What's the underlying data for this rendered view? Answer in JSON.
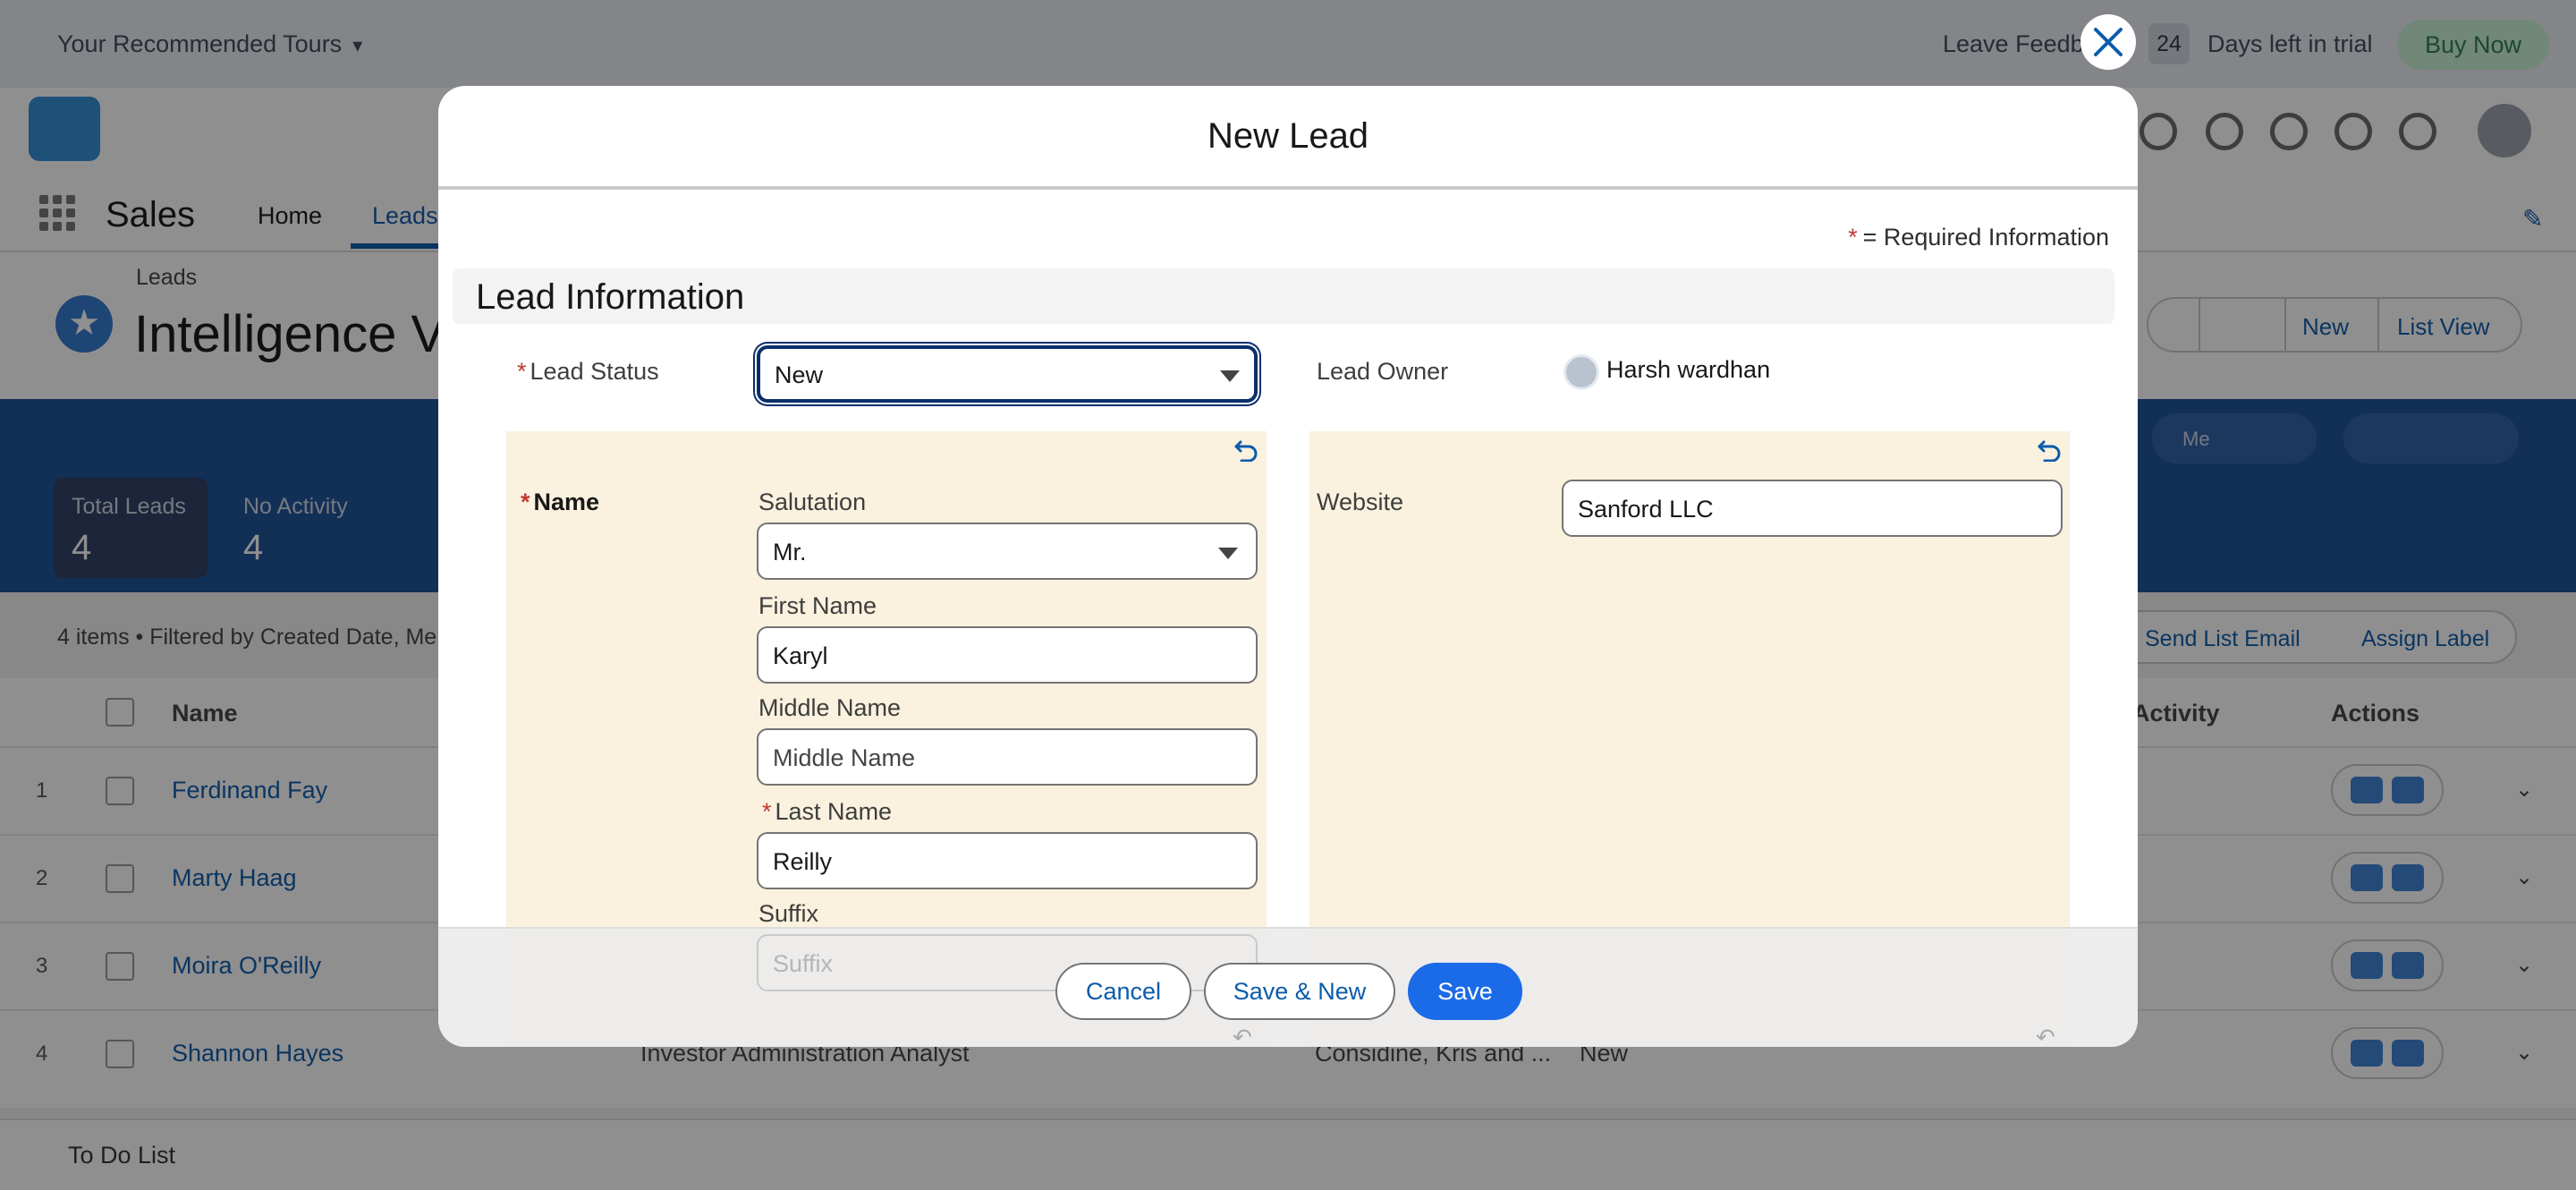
{
  "background": {
    "topbar": {
      "tours": "Your Recommended Tours",
      "feedback": "Leave Feedb",
      "trial_days": "24",
      "trial_text": "Days left in trial",
      "buy_now": "Buy Now"
    },
    "nav": {
      "app_name": "Sales",
      "home": "Home",
      "leads": "Leads"
    },
    "list": {
      "breadcrumb": "Leads",
      "title": "Intelligence Vi",
      "new_button": "New",
      "list_view_button": "List View",
      "me_filter": "Me",
      "kpi_total_label": "Total Leads",
      "kpi_total_value": "4",
      "kpi_noactivity_label": "No Activity",
      "kpi_noactivity_value": "4",
      "count_text": "4 items • Filtered by Created Date, Me",
      "send_list_email": "Send List Email",
      "assign_label": "Assign Label",
      "col_name": "Name",
      "col_activity": "Activity",
      "col_actions": "Actions",
      "rows": [
        {
          "num": "1",
          "name": "Ferdinand Fay"
        },
        {
          "num": "2",
          "name": "Marty Haag"
        },
        {
          "num": "3",
          "name": "Moira O'Reilly"
        },
        {
          "num": "4",
          "name": "Shannon Hayes"
        }
      ],
      "row4_title": "Investor Administration Analyst",
      "row4_company": "Considine, Kris and ...",
      "row4_status": "New",
      "todo": "To Do List"
    }
  },
  "modal": {
    "title": "New Lead",
    "required_star": "*",
    "required_info": "= Required Information",
    "section_title": "Lead Information",
    "lead_status_label": "Lead Status",
    "lead_status_value": "New",
    "lead_owner_label": "Lead Owner",
    "lead_owner_value": "Harsh wardhan",
    "name_label": "Name",
    "salutation_label": "Salutation",
    "salutation_value": "Mr.",
    "first_name_label": "First Name",
    "first_name_value": "Karyl",
    "middle_name_label": "Middle Name",
    "middle_name_placeholder": "Middle Name",
    "last_name_label": "Last Name",
    "last_name_value": "Reilly",
    "suffix_label": "Suffix",
    "suffix_placeholder": "Suffix",
    "website_label": "Website",
    "website_value": "Sanford LLC",
    "cancel_label": "Cancel",
    "save_new_label": "Save & New",
    "save_label": "Save"
  },
  "colors": {
    "brand": "#1b6be8",
    "link": "#0b5cab",
    "required": "#c23934",
    "edited_field_bg": "#faf1df"
  },
  "icons": [
    "close-icon",
    "undo-icon",
    "chevron-down-icon",
    "user-avatar-icon",
    "star-icon",
    "waffle-icon"
  ]
}
